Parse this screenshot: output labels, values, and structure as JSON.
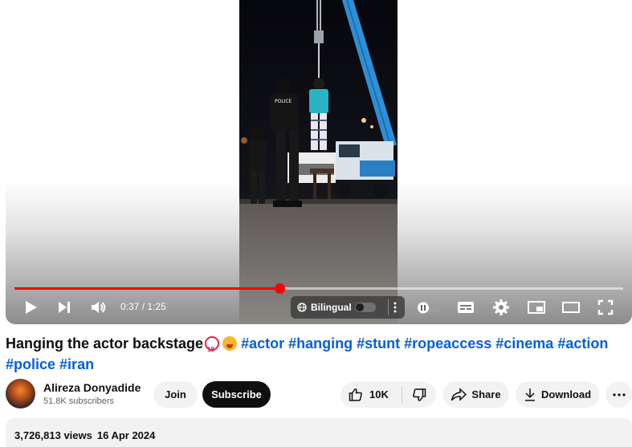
{
  "player": {
    "current_time": "0:37",
    "duration": "1:25",
    "time_separator": "/",
    "progress_fraction": 0.435,
    "accent_color": "#ff0000",
    "bilingual_label": "Bilingual",
    "video_text": {
      "police_badge": "POLICE"
    }
  },
  "video": {
    "title": "Hanging the actor backstage",
    "title_emojis": [
      "no-under-18-emoji",
      "astonished-face-emoji"
    ],
    "hashtags": [
      "#actor",
      "#hanging",
      "#stunt",
      "#ropeaccess",
      "#cinema",
      "#action",
      "#police",
      "#iran"
    ]
  },
  "channel": {
    "name": "Alireza Donyadide",
    "subscribers": "51.8K subscribers",
    "join_label": "Join",
    "subscribe_label": "Subscribe"
  },
  "actions": {
    "likes": "10K",
    "share_label": "Share",
    "download_label": "Download"
  },
  "description": {
    "views": "3,726,813 views",
    "date": "16 Apr 2024"
  },
  "colors": {
    "link": "#065fd4",
    "subscribe_bg": "#0f0f0f",
    "pill_bg": "#f2f2f2"
  }
}
